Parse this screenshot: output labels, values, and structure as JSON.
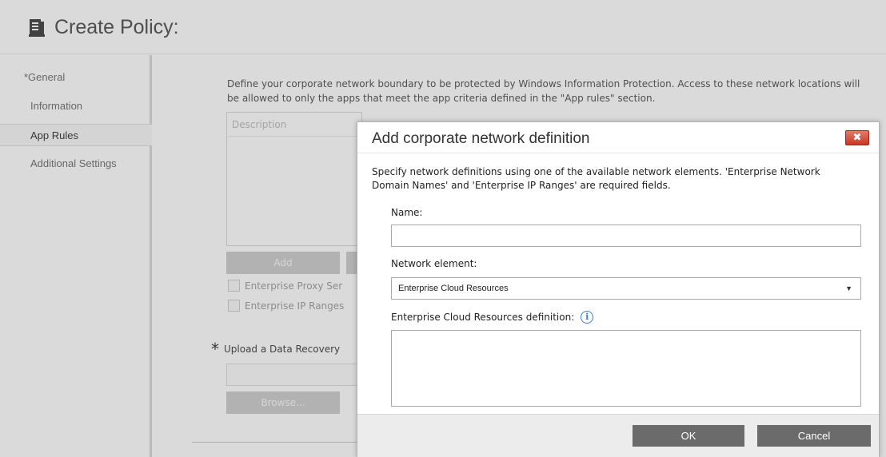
{
  "header": {
    "title": "Create Policy:",
    "icon": "policy-document-icon"
  },
  "sidebar": {
    "items": [
      {
        "label": "*General"
      },
      {
        "label": "Information"
      },
      {
        "label": "App Rules"
      },
      {
        "label": "Additional Settings"
      }
    ]
  },
  "main": {
    "description": "Define your corporate network boundary to be protected by Windows Information Protection. Access to these network locations will be allowed to only the apps that meet the app criteria defined in the \"App rules\" section.",
    "table_header": "Description",
    "add_label": "Add",
    "checkbox_proxy": "Enterprise Proxy Ser",
    "checkbox_ip": "Enterprise IP Ranges",
    "upload_star": "*",
    "upload_label": "Upload a Data Recovery",
    "browse_label": "Browse..."
  },
  "dialog": {
    "title": "Add corporate network definition",
    "close_label": "✖",
    "description": "Specify network definitions using one of the available network elements. 'Enterprise Network Domain Names' and 'Enterprise IP Ranges' are required fields.",
    "name_label": "Name:",
    "name_value": "",
    "network_element_label": "Network element:",
    "network_element_value": "Enterprise Cloud Resources",
    "definition_label": "Enterprise Cloud Resources definition:",
    "info_glyph": "i",
    "ok_label": "OK",
    "cancel_label": "Cancel"
  },
  "colors": {
    "close_button": "#c43a25",
    "dialog_button": "#6b6b6b",
    "info_icon": "#3a7bd5"
  }
}
